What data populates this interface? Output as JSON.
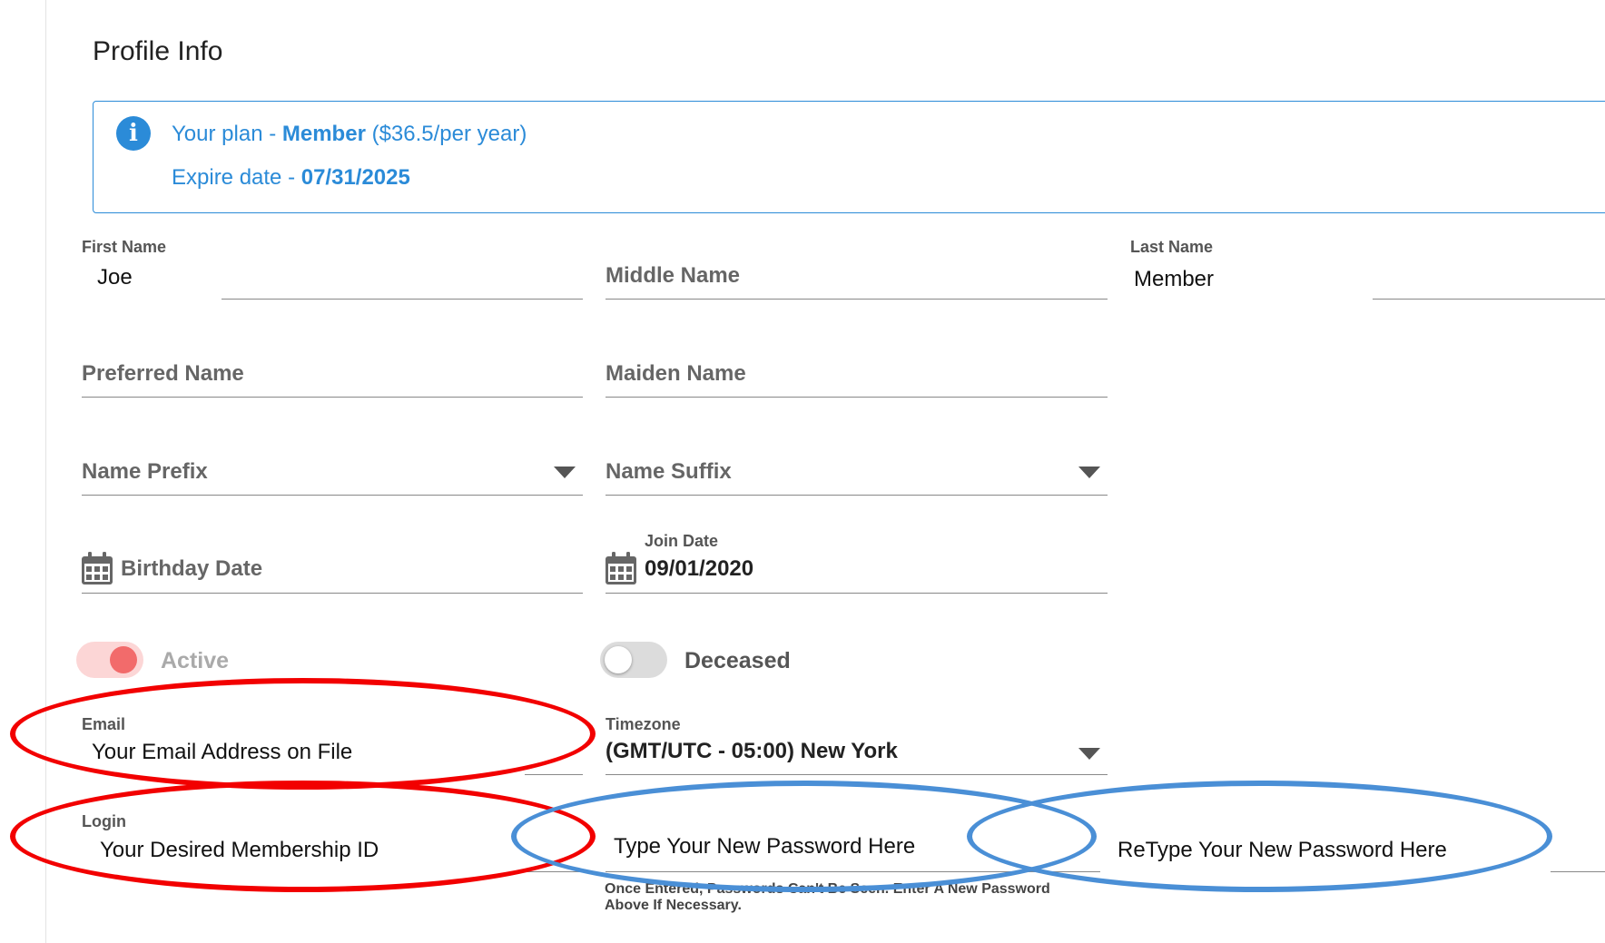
{
  "page": {
    "title": "Profile Info"
  },
  "plan": {
    "plan_prefix": "Your plan - ",
    "plan_name": "Member",
    "plan_price": " ($36.5/per year)",
    "expire_prefix": "Expire date - ",
    "expire_date": "07/31/2025",
    "accent_color": "#2b8bd8"
  },
  "fields": {
    "first_name": {
      "label": "First Name",
      "value": "Joe"
    },
    "middle_name": {
      "placeholder": "Middle Name"
    },
    "last_name": {
      "label": "Last Name",
      "value": "Member"
    },
    "preferred_name": {
      "placeholder": "Preferred Name"
    },
    "maiden_name": {
      "placeholder": "Maiden Name"
    },
    "name_prefix": {
      "placeholder": "Name Prefix"
    },
    "name_suffix": {
      "placeholder": "Name Suffix"
    },
    "birthday": {
      "placeholder": "Birthday Date",
      "icon": "calendar-icon"
    },
    "join_date": {
      "label": "Join Date",
      "value": "09/01/2020",
      "icon": "calendar-icon"
    },
    "email": {
      "label": "Email",
      "value": "Your Email Address on File"
    },
    "timezone": {
      "label": "Timezone",
      "value": "(GMT/UTC - 05:00) New York"
    },
    "login": {
      "label": "Login",
      "value": "Your Desired Membership ID"
    },
    "password": {
      "value": "Type Your New Password Here",
      "hint": "Once Entered, Passwords Can't Be Seen. Enter A New Password Above If Necessary."
    },
    "retype_password": {
      "value": "ReType Your New Password Here"
    }
  },
  "toggles": {
    "active": {
      "label": "Active",
      "on": true,
      "color": "#f26b6b"
    },
    "deceased": {
      "label": "Deceased",
      "on": false
    }
  },
  "annotations": {
    "red": "#f20000",
    "blue": "#4a8fd6"
  }
}
